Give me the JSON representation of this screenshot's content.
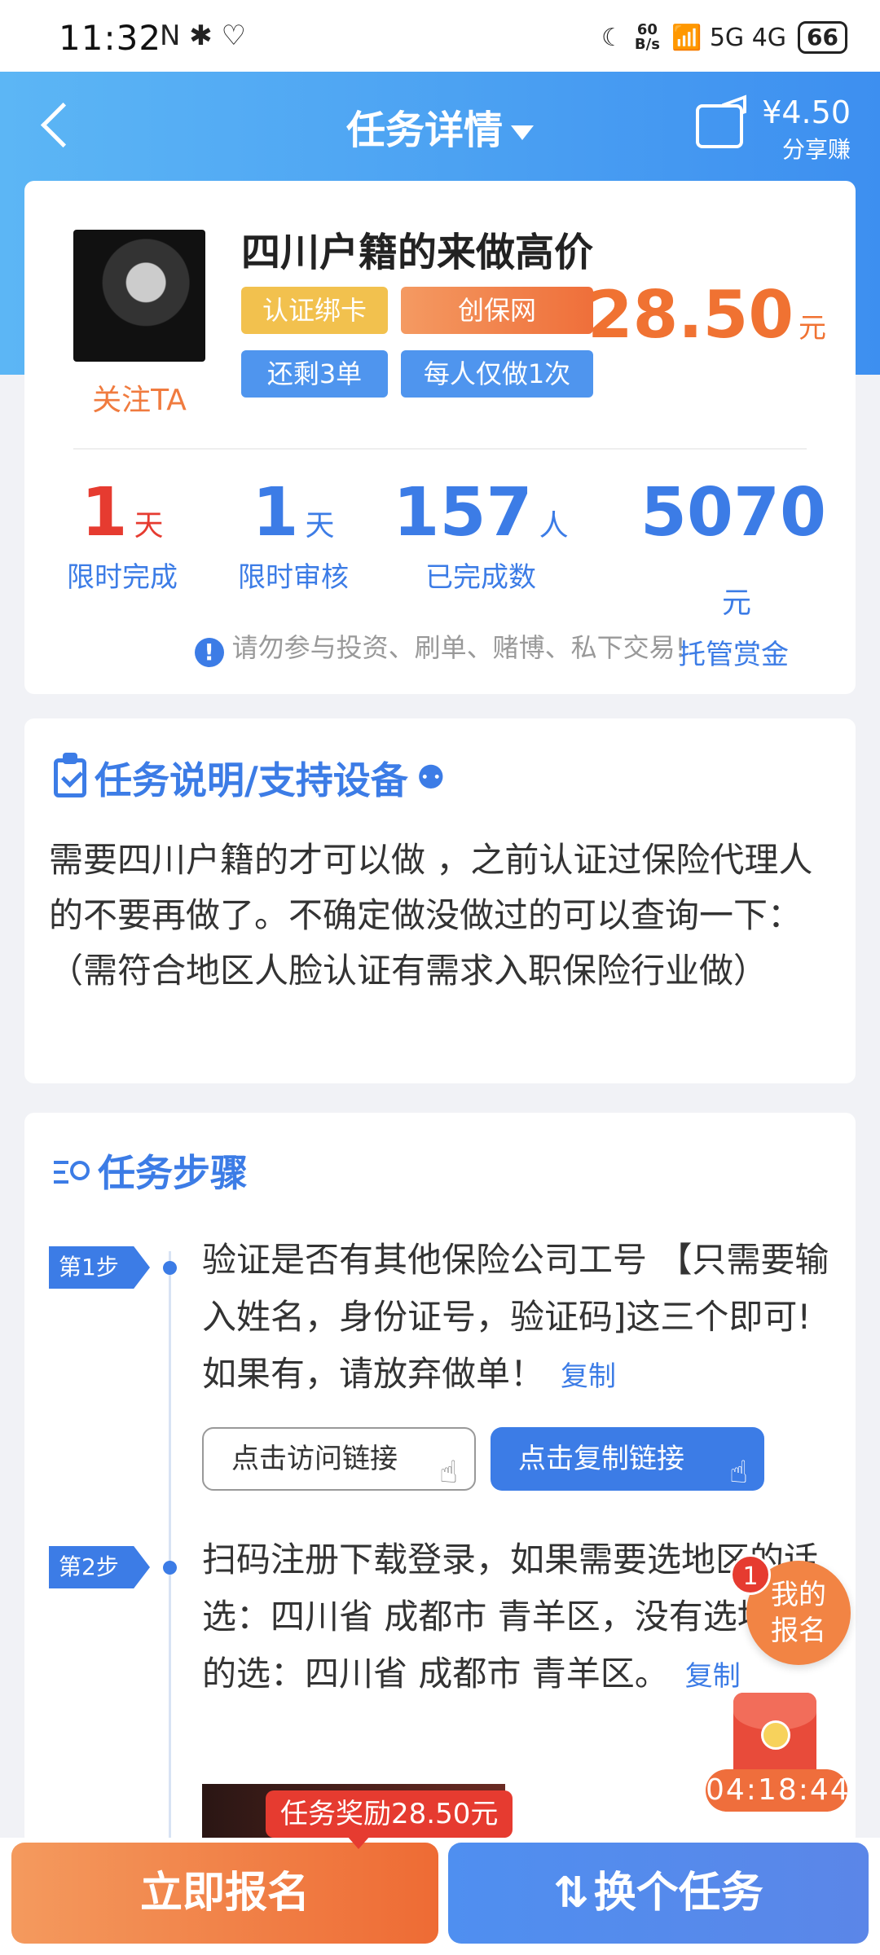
{
  "status_bar": {
    "time": "11:32",
    "left_icons": "N ✱ ♡",
    "net_speed_top": "60",
    "net_speed_bottom": "B/s",
    "signals": "📶 5G 4G",
    "battery": "66"
  },
  "nav": {
    "title": "任务详情",
    "share_amount": "¥4.50",
    "share_label": "分享赚"
  },
  "task": {
    "follow_label": "关注TA",
    "title": "四川户籍的来做高价",
    "tags": [
      "认证绑卡",
      "创保网",
      "还剩3单",
      "每人仅做1次"
    ],
    "price": "28.50",
    "price_unit": "元",
    "stats": [
      {
        "num": "1",
        "unit": "天",
        "label": "限时完成"
      },
      {
        "num": "1",
        "unit": "天",
        "label": "限时审核"
      },
      {
        "num": "157",
        "unit": "人",
        "label": "已完成数"
      },
      {
        "num": "5070",
        "unit": "元",
        "label": "托管赏金"
      }
    ],
    "warning_icon": "!",
    "warning": "请勿参与投资、刷单、赌博、私下交易!"
  },
  "description": {
    "title": "任务说明/支持设备",
    "android_icon": "android-icon",
    "apple_icon": "apple-icon",
    "text": "需要四川户籍的才可以做 ，之前认证过保险代理人的不要再做了。不确定做没做过的可以查询一下：（需符合地区人脸认证有需求入职保险行业做）"
  },
  "steps": {
    "title": "任务步骤",
    "items": [
      {
        "badge": "第1步",
        "text": "验证是否有其他保险公司工号 【只需要输入姓名，身份证号，验证码]这三个即可!如果有，请放弃做单！",
        "copy": "复制",
        "visit_btn": "点击访问链接",
        "copy_btn": "点击复制链接"
      },
      {
        "badge": "第2步",
        "text": "扫码注册下载登录，如果需要选地区的话选：四川省 成都市 青羊区，没有选地区的选：四川省 成都市 青羊区。",
        "copy": "复制"
      }
    ]
  },
  "floating": {
    "badge_count": "1",
    "signup_label_1": "我的",
    "signup_label_2": "报名",
    "timer": "04:18:44"
  },
  "bottom": {
    "reward_tip": "任务奖励28.50元",
    "signup_btn": "立即报名",
    "change_btn": "换个任务"
  }
}
